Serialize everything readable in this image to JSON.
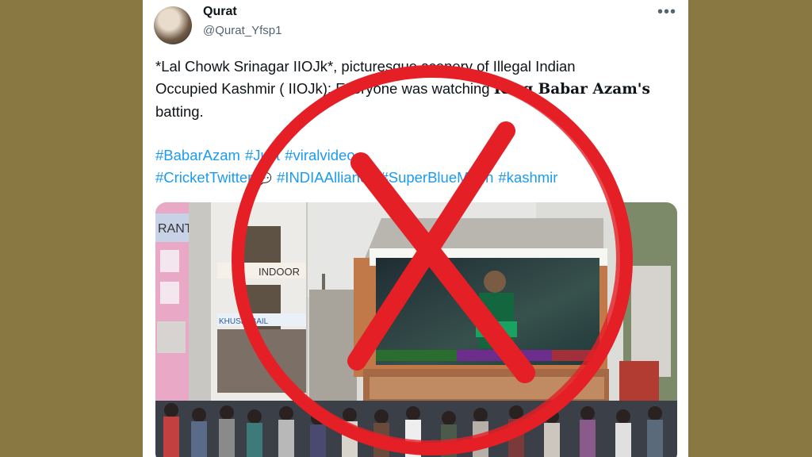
{
  "tweet": {
    "author_name": "Qurat",
    "author_handle": "@Qurat_Yfsp1",
    "more_icon": "•••",
    "text_line1": "*Lal Chowk Srinagar IIOJk*, picturesque scenery of Illegal Indian",
    "text_line2_a": "Occupied Kashmir ( IIOJk): Everyone was watching ",
    "text_line2_bold": "King Babar Azam's",
    "text_line3": "batting.",
    "hashtags_line1": [
      "#BabarAzam",
      "#Just",
      "#viralvideo"
    ],
    "hashtags_line2": [
      "#CricketTwitter",
      "#INDIAAlliance",
      "#SuperBlueMoon",
      "#kashmir"
    ],
    "emoji_icon": "💬"
  },
  "media": {
    "sign_rant": "RANT",
    "sign_indoor": "INDOOR",
    "sign_khushi": "KHUSHI BAIL"
  },
  "overlay": {
    "mark_color": "#e51f26",
    "mark_icon": "cross-mark-icon"
  }
}
